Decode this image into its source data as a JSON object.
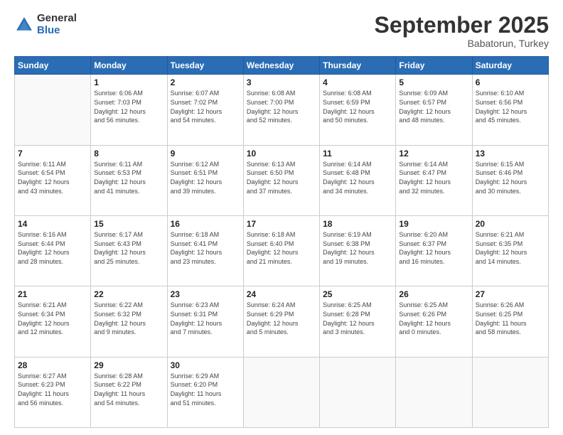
{
  "logo": {
    "general": "General",
    "blue": "Blue"
  },
  "header": {
    "month": "September 2025",
    "location": "Babatorun, Turkey"
  },
  "weekdays": [
    "Sunday",
    "Monday",
    "Tuesday",
    "Wednesday",
    "Thursday",
    "Friday",
    "Saturday"
  ],
  "weeks": [
    [
      {
        "day": "",
        "info": ""
      },
      {
        "day": "1",
        "info": "Sunrise: 6:06 AM\nSunset: 7:03 PM\nDaylight: 12 hours\nand 56 minutes."
      },
      {
        "day": "2",
        "info": "Sunrise: 6:07 AM\nSunset: 7:02 PM\nDaylight: 12 hours\nand 54 minutes."
      },
      {
        "day": "3",
        "info": "Sunrise: 6:08 AM\nSunset: 7:00 PM\nDaylight: 12 hours\nand 52 minutes."
      },
      {
        "day": "4",
        "info": "Sunrise: 6:08 AM\nSunset: 6:59 PM\nDaylight: 12 hours\nand 50 minutes."
      },
      {
        "day": "5",
        "info": "Sunrise: 6:09 AM\nSunset: 6:57 PM\nDaylight: 12 hours\nand 48 minutes."
      },
      {
        "day": "6",
        "info": "Sunrise: 6:10 AM\nSunset: 6:56 PM\nDaylight: 12 hours\nand 45 minutes."
      }
    ],
    [
      {
        "day": "7",
        "info": "Sunrise: 6:11 AM\nSunset: 6:54 PM\nDaylight: 12 hours\nand 43 minutes."
      },
      {
        "day": "8",
        "info": "Sunrise: 6:11 AM\nSunset: 6:53 PM\nDaylight: 12 hours\nand 41 minutes."
      },
      {
        "day": "9",
        "info": "Sunrise: 6:12 AM\nSunset: 6:51 PM\nDaylight: 12 hours\nand 39 minutes."
      },
      {
        "day": "10",
        "info": "Sunrise: 6:13 AM\nSunset: 6:50 PM\nDaylight: 12 hours\nand 37 minutes."
      },
      {
        "day": "11",
        "info": "Sunrise: 6:14 AM\nSunset: 6:48 PM\nDaylight: 12 hours\nand 34 minutes."
      },
      {
        "day": "12",
        "info": "Sunrise: 6:14 AM\nSunset: 6:47 PM\nDaylight: 12 hours\nand 32 minutes."
      },
      {
        "day": "13",
        "info": "Sunrise: 6:15 AM\nSunset: 6:46 PM\nDaylight: 12 hours\nand 30 minutes."
      }
    ],
    [
      {
        "day": "14",
        "info": "Sunrise: 6:16 AM\nSunset: 6:44 PM\nDaylight: 12 hours\nand 28 minutes."
      },
      {
        "day": "15",
        "info": "Sunrise: 6:17 AM\nSunset: 6:43 PM\nDaylight: 12 hours\nand 25 minutes."
      },
      {
        "day": "16",
        "info": "Sunrise: 6:18 AM\nSunset: 6:41 PM\nDaylight: 12 hours\nand 23 minutes."
      },
      {
        "day": "17",
        "info": "Sunrise: 6:18 AM\nSunset: 6:40 PM\nDaylight: 12 hours\nand 21 minutes."
      },
      {
        "day": "18",
        "info": "Sunrise: 6:19 AM\nSunset: 6:38 PM\nDaylight: 12 hours\nand 19 minutes."
      },
      {
        "day": "19",
        "info": "Sunrise: 6:20 AM\nSunset: 6:37 PM\nDaylight: 12 hours\nand 16 minutes."
      },
      {
        "day": "20",
        "info": "Sunrise: 6:21 AM\nSunset: 6:35 PM\nDaylight: 12 hours\nand 14 minutes."
      }
    ],
    [
      {
        "day": "21",
        "info": "Sunrise: 6:21 AM\nSunset: 6:34 PM\nDaylight: 12 hours\nand 12 minutes."
      },
      {
        "day": "22",
        "info": "Sunrise: 6:22 AM\nSunset: 6:32 PM\nDaylight: 12 hours\nand 9 minutes."
      },
      {
        "day": "23",
        "info": "Sunrise: 6:23 AM\nSunset: 6:31 PM\nDaylight: 12 hours\nand 7 minutes."
      },
      {
        "day": "24",
        "info": "Sunrise: 6:24 AM\nSunset: 6:29 PM\nDaylight: 12 hours\nand 5 minutes."
      },
      {
        "day": "25",
        "info": "Sunrise: 6:25 AM\nSunset: 6:28 PM\nDaylight: 12 hours\nand 3 minutes."
      },
      {
        "day": "26",
        "info": "Sunrise: 6:25 AM\nSunset: 6:26 PM\nDaylight: 12 hours\nand 0 minutes."
      },
      {
        "day": "27",
        "info": "Sunrise: 6:26 AM\nSunset: 6:25 PM\nDaylight: 11 hours\nand 58 minutes."
      }
    ],
    [
      {
        "day": "28",
        "info": "Sunrise: 6:27 AM\nSunset: 6:23 PM\nDaylight: 11 hours\nand 56 minutes."
      },
      {
        "day": "29",
        "info": "Sunrise: 6:28 AM\nSunset: 6:22 PM\nDaylight: 11 hours\nand 54 minutes."
      },
      {
        "day": "30",
        "info": "Sunrise: 6:29 AM\nSunset: 6:20 PM\nDaylight: 11 hours\nand 51 minutes."
      },
      {
        "day": "",
        "info": ""
      },
      {
        "day": "",
        "info": ""
      },
      {
        "day": "",
        "info": ""
      },
      {
        "day": "",
        "info": ""
      }
    ]
  ]
}
